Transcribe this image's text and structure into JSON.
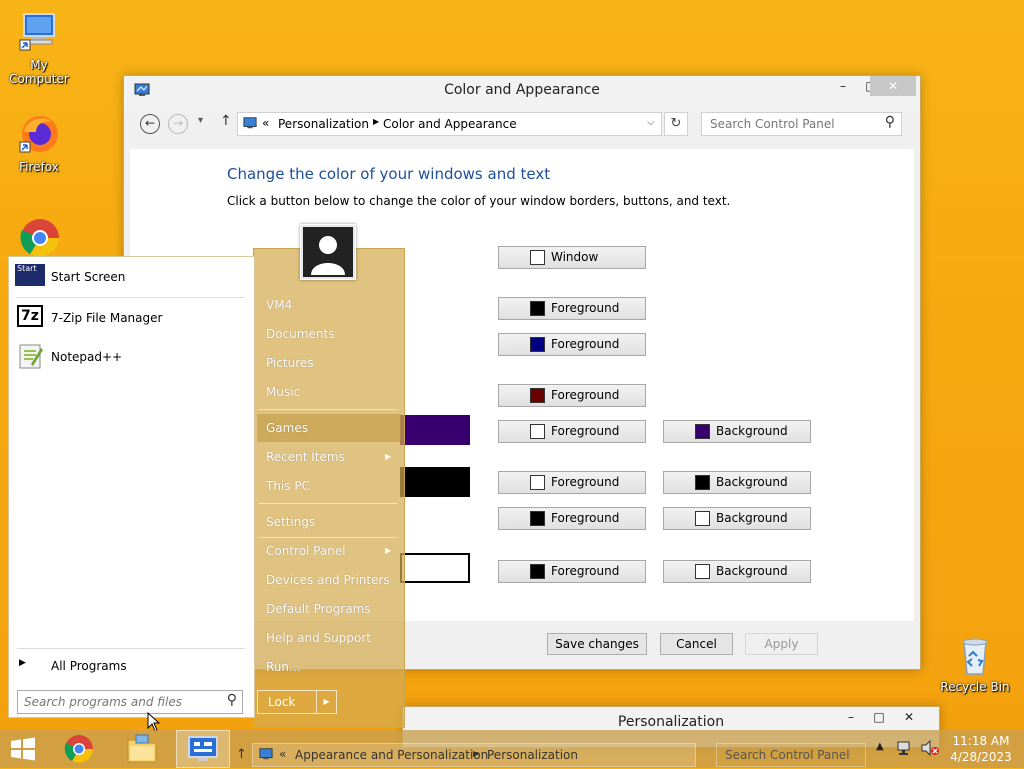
{
  "desktop": {
    "icons": [
      {
        "label": "My Computer",
        "icon": "computer-icon"
      },
      {
        "label": "Firefox",
        "icon": "firefox-icon"
      },
      {
        "label": "Google Chrome",
        "icon": "chrome-icon"
      },
      {
        "label": "Recycle Bin",
        "icon": "recycle-bin-icon"
      }
    ]
  },
  "window": {
    "title": "Color and Appearance",
    "breadcrumb": {
      "prefix": "«",
      "items": [
        "Personalization",
        "Color and Appearance"
      ]
    },
    "search_placeholder": "Search Control Panel",
    "heading": "Change the color of your windows and text",
    "description": "Click a button below to change the color of your window borders, buttons, and text.",
    "rows": [
      {
        "fg": {
          "label": "Window",
          "color": "#ffffff"
        }
      },
      {
        "fg": {
          "label": "Foreground",
          "color": "#000000"
        }
      },
      {
        "fg": {
          "label": "Foreground",
          "color": "#000080"
        }
      },
      {
        "fg": {
          "label": "Foreground",
          "color": "#6a0000"
        }
      },
      {
        "fg": {
          "label": "Foreground",
          "color": "#ffffff"
        },
        "bg": {
          "label": "Background",
          "color": "#37006e"
        }
      },
      {
        "fg": {
          "label": "Foreground",
          "color": "#ffffff"
        },
        "bg": {
          "label": "Background",
          "color": "#000000"
        }
      },
      {
        "fg": {
          "label": "Foreground",
          "color": "#000000"
        },
        "bg": {
          "label": "Background",
          "color": "#ffffff"
        }
      },
      {
        "fg": {
          "label": "Foreground",
          "color": "#000000"
        },
        "bg": {
          "label": "Background",
          "color": "#ffffff"
        }
      }
    ],
    "preview_colors": [
      "#37006e",
      "#000000",
      "#ffffff"
    ],
    "buttons": {
      "save": "Save changes",
      "cancel": "Cancel",
      "apply": "Apply"
    }
  },
  "second_window": {
    "title": "Personalization",
    "breadcrumb": {
      "prefix": "«",
      "items": [
        "Appearance and Personalization",
        "Personalization"
      ]
    },
    "search_placeholder": "Search Control Panel"
  },
  "start_menu": {
    "pinned": [
      {
        "label": "Start Screen",
        "icon": "start-screen-icon",
        "icon_text": "Start"
      },
      {
        "label": "7-Zip File Manager",
        "icon": "7zip-icon",
        "icon_text": "7z"
      },
      {
        "label": "Notepad++",
        "icon": "notepadpp-icon"
      }
    ],
    "all_programs": "All Programs",
    "search_placeholder": "Search programs and files",
    "right_items": [
      {
        "label": "VM4"
      },
      {
        "label": "Documents"
      },
      {
        "label": "Pictures"
      },
      {
        "label": "Music"
      },
      {
        "label": "Games"
      },
      {
        "label": "Recent Items",
        "arrow": true
      },
      {
        "label": "This PC"
      },
      {
        "label": "Settings"
      },
      {
        "label": "Control Panel",
        "arrow": true
      },
      {
        "label": "Devices and Printers"
      },
      {
        "label": "Default Programs"
      },
      {
        "label": "Help and Support"
      },
      {
        "label": "Run..."
      }
    ],
    "lock": "Lock"
  },
  "taskbar": {
    "time": "11:18 AM",
    "date": "4/28/2023"
  }
}
